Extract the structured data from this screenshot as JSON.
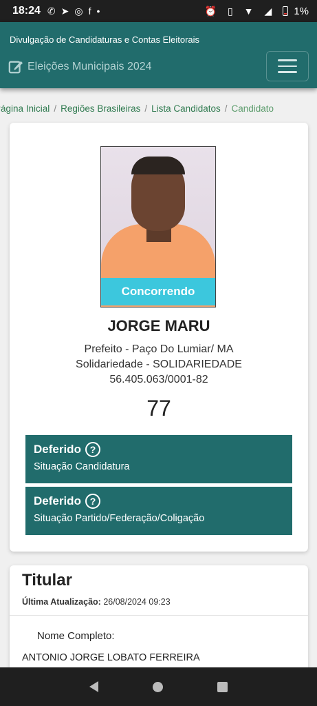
{
  "status_bar": {
    "time": "18:24",
    "battery": "1%"
  },
  "header": {
    "subtitle": "Divulgação de Candidaturas e Contas Eleitorais",
    "brand": "Eleições Municipais 2024"
  },
  "breadcrumb": [
    "Página Inicial",
    "Regiões Brasileiras",
    "Lista Candidatos",
    "Candidato"
  ],
  "candidate": {
    "status_badge": "Concorrendo",
    "name": "JORGE MARU",
    "office": "Prefeito - Paço Do Lumiar/ MA",
    "party": "Solidariedade - SOLIDARIEDADE",
    "cnpj": "56.405.063/0001-82",
    "number": "77"
  },
  "situations": [
    {
      "title": "Deferido",
      "description": "Situação Candidatura"
    },
    {
      "title": "Deferido",
      "description": "Situação Partido/Federação/Coligação"
    }
  ],
  "titular": {
    "heading": "Titular",
    "updated_label": "Última Atualização:",
    "updated_value": "26/08/2024 09:23",
    "full_name_label": "Nome Completo:",
    "full_name": "ANTONIO JORGE LOBATO FERREIRA"
  },
  "colors": {
    "header": "#216c6c",
    "badge": "#3cc7dd",
    "breadcrumb": "#2f7a4f"
  }
}
